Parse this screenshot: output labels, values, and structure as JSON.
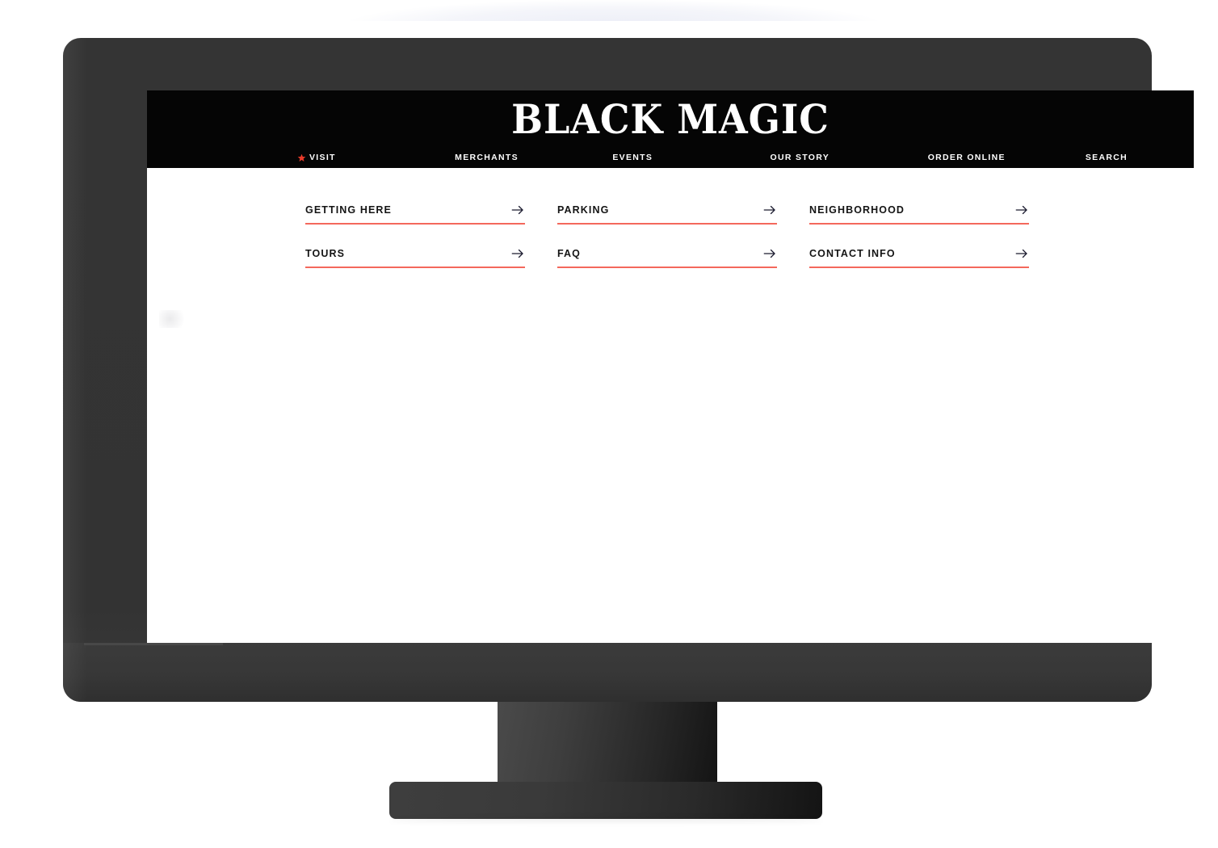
{
  "site": {
    "brand": "BLACK MAGIC",
    "nav": [
      {
        "label": "VISIT",
        "icon": "star-icon",
        "active": true
      },
      {
        "label": "MERCHANTS",
        "active": false
      },
      {
        "label": "EVENTS",
        "active": false
      },
      {
        "label": "OUR STORY",
        "active": false
      },
      {
        "label": "ORDER ONLINE",
        "active": false
      },
      {
        "label": "SEARCH",
        "active": false
      }
    ],
    "submenu": [
      {
        "label": "GETTING HERE",
        "icon": "arrow-right-icon"
      },
      {
        "label": "PARKING",
        "icon": "arrow-right-icon"
      },
      {
        "label": "NEIGHBORHOOD",
        "icon": "arrow-right-icon"
      },
      {
        "label": "TOURS",
        "icon": "arrow-right-icon"
      },
      {
        "label": "FAQ",
        "icon": "arrow-right-icon"
      },
      {
        "label": "CONTACT INFO",
        "icon": "arrow-right-icon"
      }
    ]
  },
  "colors": {
    "header_background": "#050505",
    "page_background": "#ffffff",
    "accent_red": "#f4685c",
    "star_red": "#ea3b2a",
    "text_dark": "#141414",
    "bezel": "#333333"
  }
}
